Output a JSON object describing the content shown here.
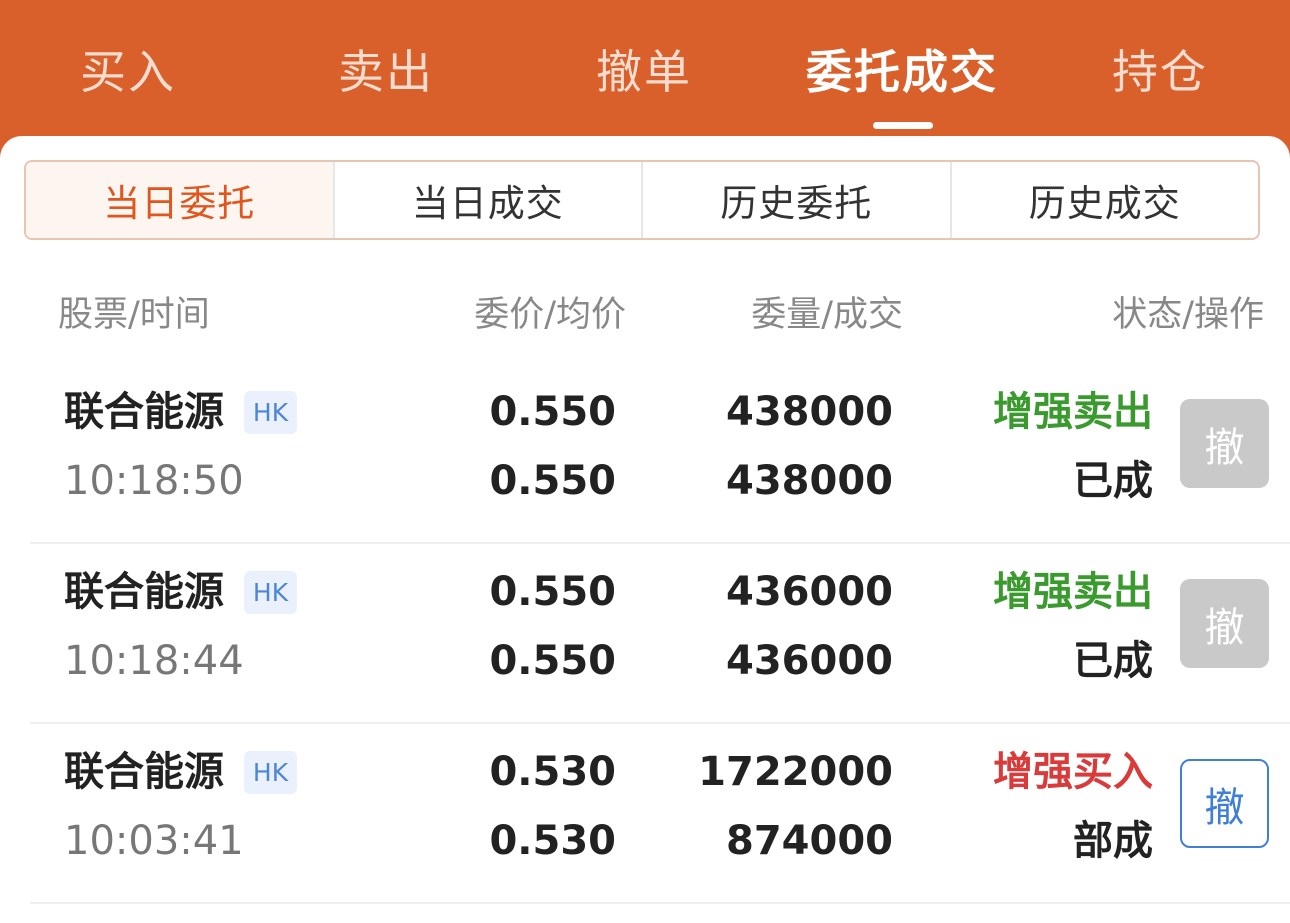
{
  "colors": {
    "header_bg": "#d9602a",
    "accent": "#e0561f",
    "sell_green": "#3a9a2e",
    "buy_red": "#d93a3a",
    "hk_blue": "#4f86d4"
  },
  "top_tabs": [
    {
      "label": "买入"
    },
    {
      "label": "卖出"
    },
    {
      "label": "撤单"
    },
    {
      "label": "委托成交",
      "active": true
    },
    {
      "label": "持仓"
    }
  ],
  "segments": [
    {
      "label": "当日委托",
      "active": true
    },
    {
      "label": "当日成交"
    },
    {
      "label": "历史委托"
    },
    {
      "label": "历史成交"
    }
  ],
  "columns": {
    "stock_time": "股票/时间",
    "price": "委价/均价",
    "quantity": "委量/成交",
    "status": "状态/操作"
  },
  "orders": [
    {
      "name": "联合能源",
      "market": "HK",
      "time": "10:18:50",
      "order_price": "0.550",
      "avg_price": "0.550",
      "order_qty": "438000",
      "filled_qty": "438000",
      "type": "增强卖出",
      "type_color": "#3a9a2e",
      "status": "已成",
      "cancel_label": "撤",
      "cancelable": false
    },
    {
      "name": "联合能源",
      "market": "HK",
      "time": "10:18:44",
      "order_price": "0.550",
      "avg_price": "0.550",
      "order_qty": "436000",
      "filled_qty": "436000",
      "type": "增强卖出",
      "type_color": "#3a9a2e",
      "status": "已成",
      "cancel_label": "撤",
      "cancelable": false
    },
    {
      "name": "联合能源",
      "market": "HK",
      "time": "10:03:41",
      "order_price": "0.530",
      "avg_price": "0.530",
      "order_qty": "1722000",
      "filled_qty": "874000",
      "type": "增强买入",
      "type_color": "#d93a3a",
      "status": "部成",
      "cancel_label": "撤",
      "cancelable": true
    }
  ]
}
